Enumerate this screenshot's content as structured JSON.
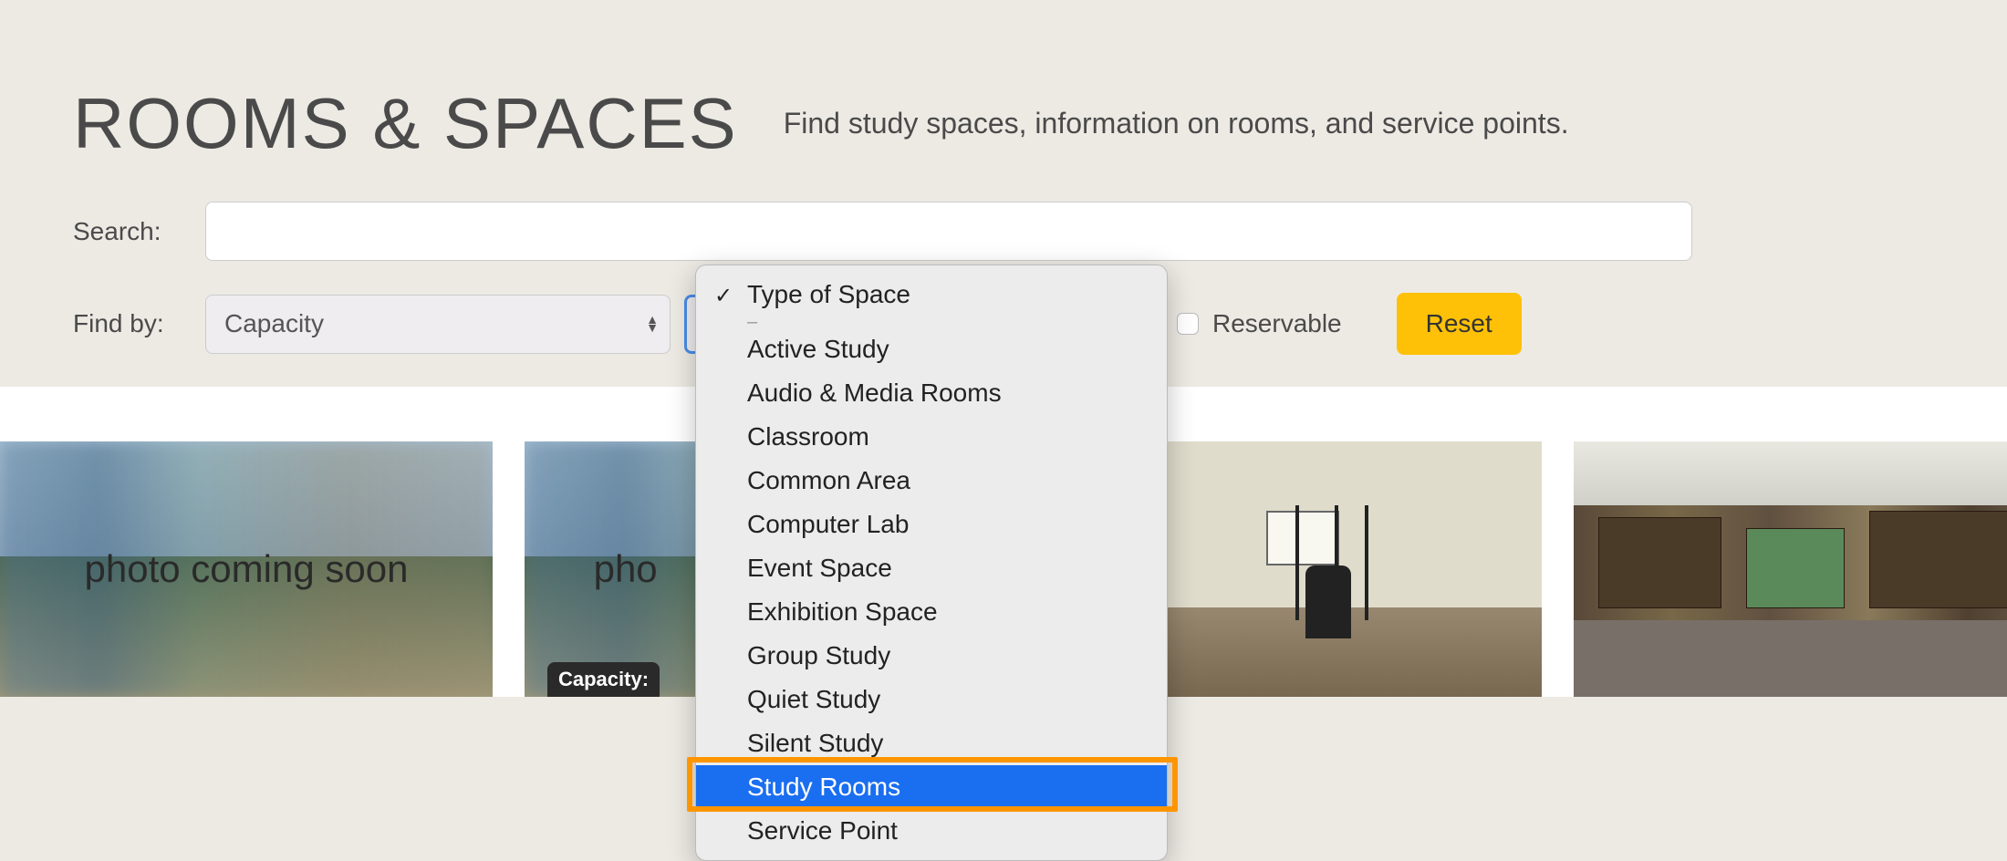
{
  "header": {
    "title": "ROOMS & SPACES",
    "subtitle": "Find study spaces, information on rooms, and service points."
  },
  "filters": {
    "search_label": "Search:",
    "findby_label": "Find by:",
    "capacity_select": "Capacity",
    "type_select_visible": "",
    "reservable_label": "Reservable",
    "reset_label": "Reset"
  },
  "dropdown": {
    "header": "Type of Space",
    "selected_index": 10,
    "items": [
      "Active Study",
      "Audio & Media Rooms",
      "Classroom",
      "Common Area",
      "Computer Lab",
      "Event Space",
      "Exhibition Space",
      "Group Study",
      "Quiet Study",
      "Silent Study",
      "Study Rooms",
      "Service Point"
    ]
  },
  "cards": {
    "placeholder_text": "photo coming soon",
    "capacity_badge": "Capacity:"
  }
}
